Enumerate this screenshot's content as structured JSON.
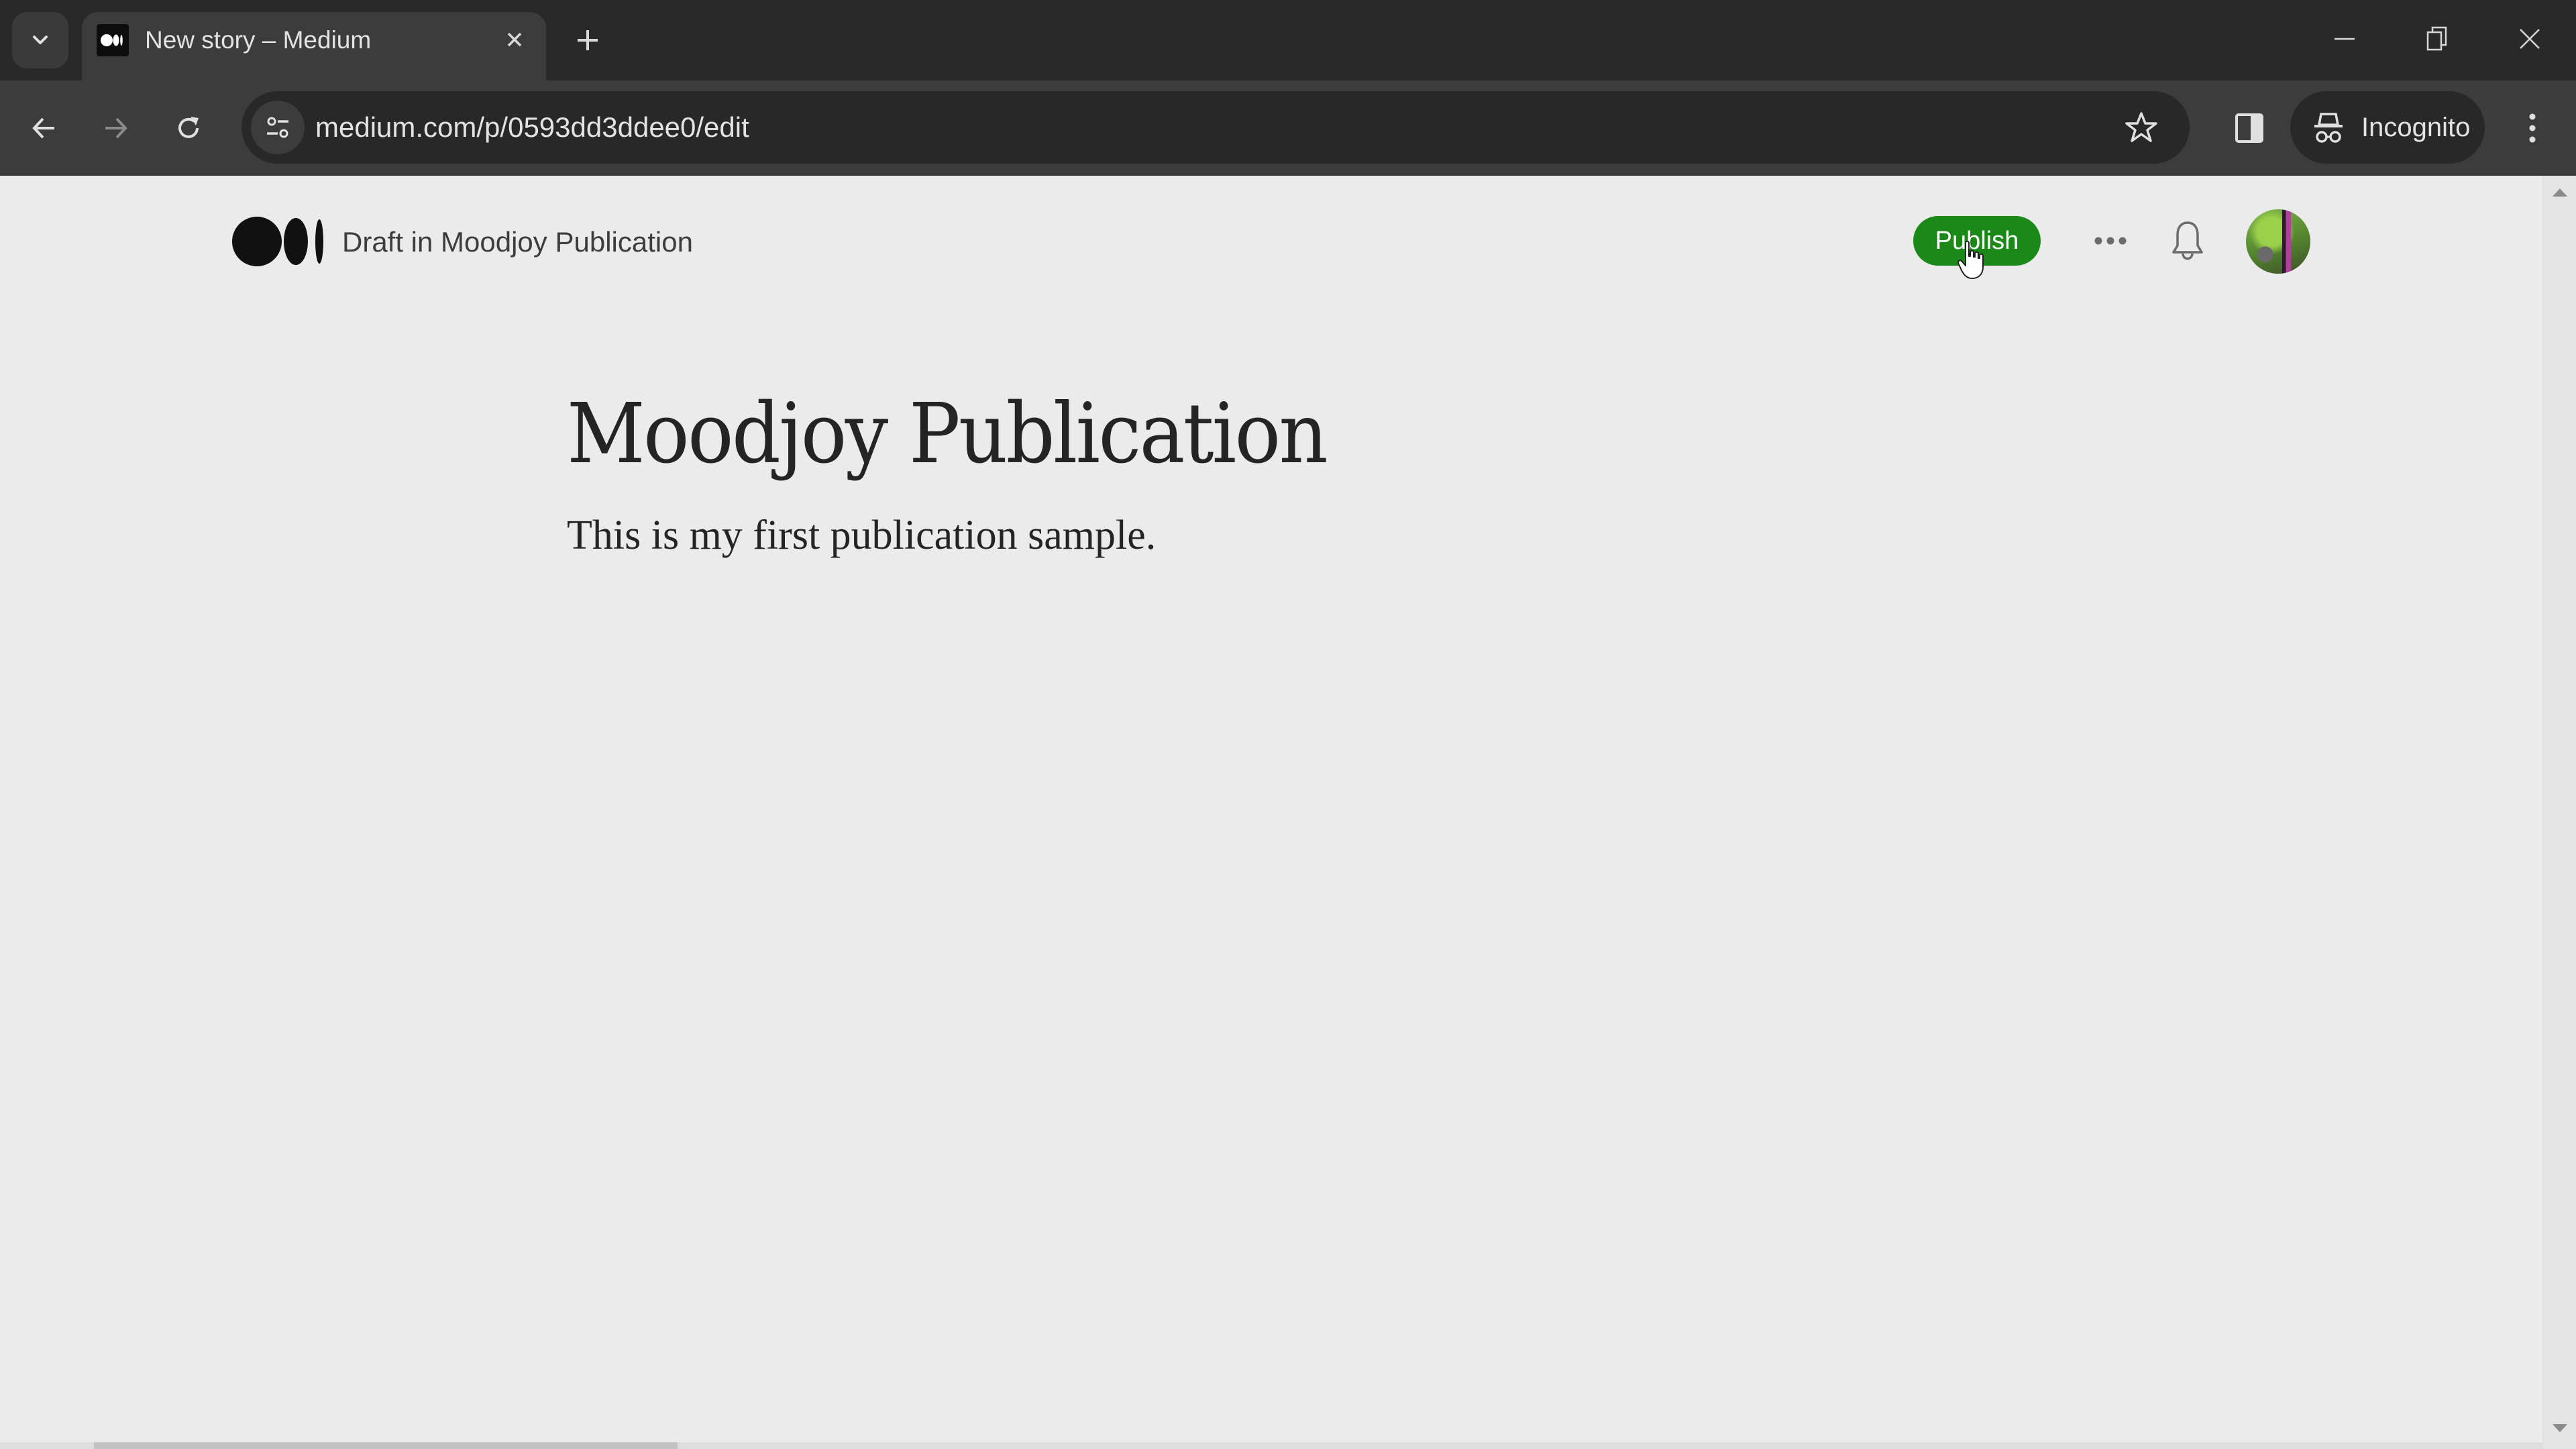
{
  "browser": {
    "tab": {
      "title": "New story – Medium",
      "favicon": "medium-logo-icon",
      "close_icon": "close-icon"
    },
    "new_tab_icon": "plus-icon",
    "tab_search_icon": "chevron-down-icon",
    "window_controls": [
      "minimize-icon",
      "restore-icon",
      "close-icon"
    ],
    "nav": {
      "back_icon": "arrow-left-icon",
      "forward_icon": "arrow-right-icon",
      "reload_icon": "reload-icon"
    },
    "address_bar": {
      "url": "medium.com/p/0593dd3ddee0/edit",
      "site_info_icon": "tune-icon",
      "bookmark_icon": "star-icon"
    },
    "side_panel_icon": "side-panel-icon",
    "incognito": {
      "label": "Incognito",
      "icon": "incognito-icon"
    },
    "menu_icon": "kebab-menu-icon"
  },
  "header": {
    "logo": "medium-logo-icon",
    "draft_label": "Draft in Moodjoy Publication",
    "publish_label": "Publish",
    "more_icon": "more-horizontal-icon",
    "notifications_icon": "bell-icon",
    "avatar": "user-avatar"
  },
  "story": {
    "title": "Moodjoy Publication",
    "body": "This is my first publication sample."
  },
  "colors": {
    "publish_green": "#1a8917",
    "page_background": "#ebebeb",
    "text": "#242424",
    "chrome_dark": "#292929",
    "chrome_toolbar": "#3c3c3c"
  }
}
